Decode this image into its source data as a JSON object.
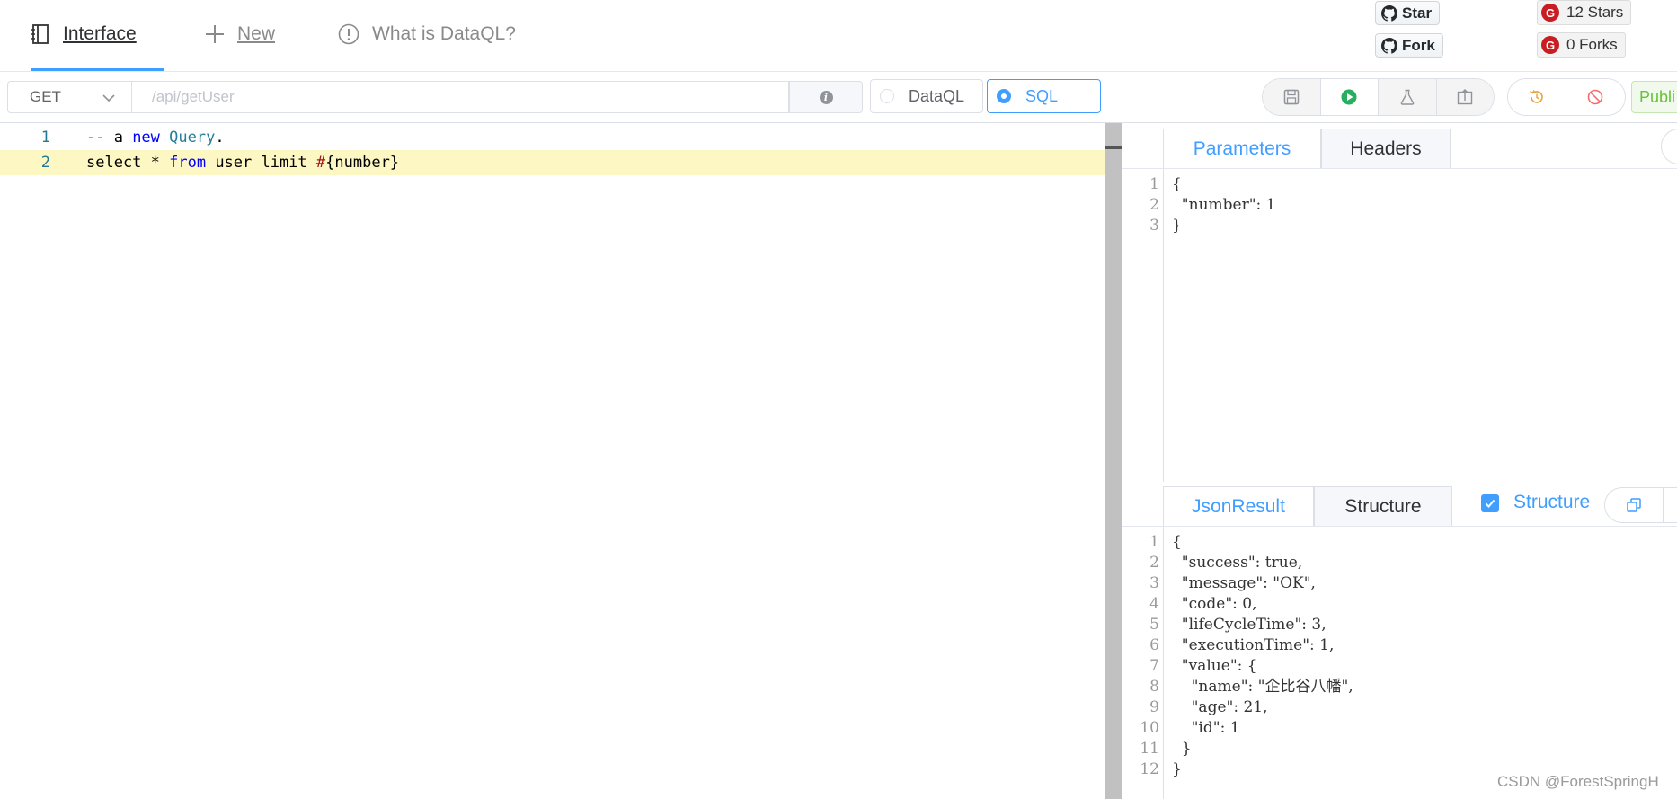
{
  "nav": {
    "tabs": [
      {
        "label": "Interface"
      },
      {
        "label": "New"
      },
      {
        "label": "What is DataQL?"
      }
    ],
    "github": {
      "star_label": "Star",
      "fork_label": "Fork"
    },
    "gitee": {
      "stars_label": "12 Stars",
      "forks_label": "0 Forks"
    }
  },
  "toolbar": {
    "method": "GET",
    "api_path_placeholder": "/api/getUser",
    "modes": [
      {
        "label": "DataQL",
        "checked": false
      },
      {
        "label": "SQL",
        "checked": true
      }
    ],
    "publish_label": "Publi"
  },
  "editor": {
    "lines": [
      {
        "n": "1",
        "text": "-- a new Query."
      },
      {
        "n": "2",
        "text": "select * from user limit #{number}"
      }
    ]
  },
  "params_panel": {
    "tabs": [
      {
        "label": "Parameters",
        "active": true
      },
      {
        "label": "Headers",
        "active": false
      }
    ],
    "lines": [
      {
        "n": "1",
        "text": "{"
      },
      {
        "n": "2",
        "text": "  \"number\": 1"
      },
      {
        "n": "3",
        "text": "}"
      }
    ]
  },
  "result_panel": {
    "tabs": [
      {
        "label": "JsonResult",
        "active": true
      },
      {
        "label": "Structure",
        "active": false
      }
    ],
    "structure_checkbox_label": "Structure",
    "lines": [
      {
        "n": "1",
        "text": "{"
      },
      {
        "n": "2",
        "text": "  \"success\": true,"
      },
      {
        "n": "3",
        "text": "  \"message\": \"OK\","
      },
      {
        "n": "4",
        "text": "  \"code\": 0,"
      },
      {
        "n": "5",
        "text": "  \"lifeCycleTime\": 3,"
      },
      {
        "n": "6",
        "text": "  \"executionTime\": 1,"
      },
      {
        "n": "7",
        "text": "  \"value\": {"
      },
      {
        "n": "8",
        "text": "    \"name\": \"企比谷八幡\","
      },
      {
        "n": "9",
        "text": "    \"age\": 21,"
      },
      {
        "n": "10",
        "text": "    \"id\": 1"
      },
      {
        "n": "11",
        "text": "  }"
      },
      {
        "n": "12",
        "text": "}"
      }
    ]
  },
  "watermark": "CSDN @ForestSpringH",
  "colors": {
    "accent": "#409eff",
    "success": "#67c23a",
    "warning": "#e6a23c",
    "danger": "#f56c6c"
  }
}
